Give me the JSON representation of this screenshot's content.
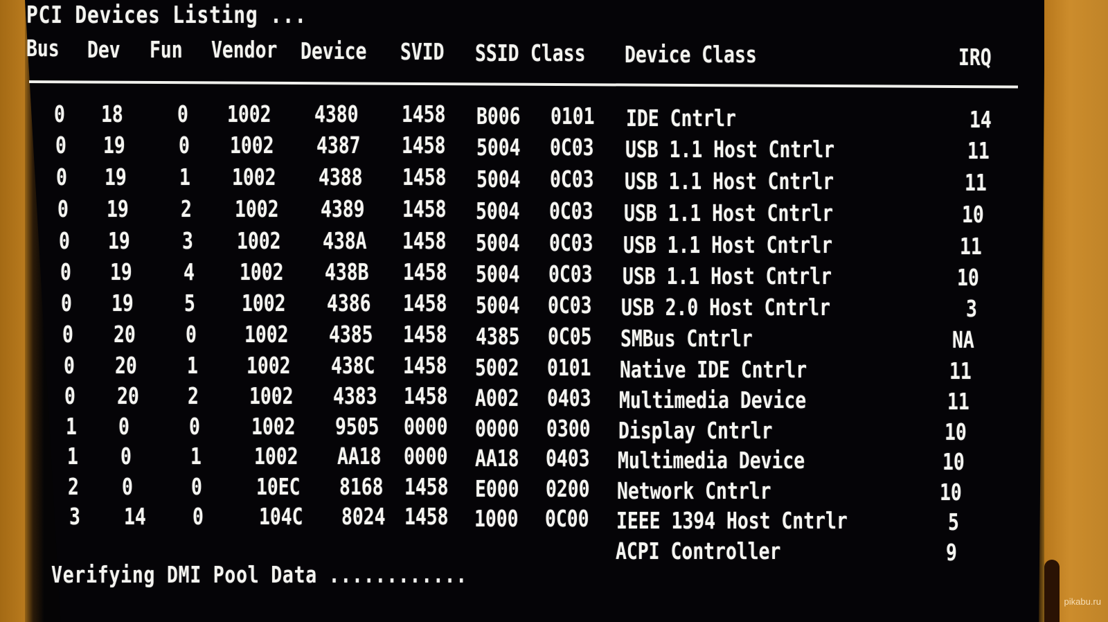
{
  "screen": {
    "title": "PCI Devices Listing ...",
    "columns": {
      "bus": "Bus",
      "dev": "Dev",
      "fun": "Fun",
      "vendor": "Vendor",
      "device": "Device",
      "svid": "SVID",
      "ssid": "SSID",
      "class": "Class",
      "device_class": "Device Class",
      "irq": "IRQ"
    },
    "rows": [
      {
        "bus": "0",
        "dev": "18",
        "fun": "0",
        "vendor": "1002",
        "device": "4380",
        "svid": "1458",
        "ssid": "B006",
        "class": "0101",
        "device_class": "IDE Cntrlr",
        "irq": "14"
      },
      {
        "bus": "0",
        "dev": "19",
        "fun": "0",
        "vendor": "1002",
        "device": "4387",
        "svid": "1458",
        "ssid": "5004",
        "class": "0C03",
        "device_class": "USB 1.1 Host Cntrlr",
        "irq": "11"
      },
      {
        "bus": "0",
        "dev": "19",
        "fun": "1",
        "vendor": "1002",
        "device": "4388",
        "svid": "1458",
        "ssid": "5004",
        "class": "0C03",
        "device_class": "USB 1.1 Host Cntrlr",
        "irq": "11"
      },
      {
        "bus": "0",
        "dev": "19",
        "fun": "2",
        "vendor": "1002",
        "device": "4389",
        "svid": "1458",
        "ssid": "5004",
        "class": "0C03",
        "device_class": "USB 1.1 Host Cntrlr",
        "irq": "10"
      },
      {
        "bus": "0",
        "dev": "19",
        "fun": "3",
        "vendor": "1002",
        "device": "438A",
        "svid": "1458",
        "ssid": "5004",
        "class": "0C03",
        "device_class": "USB 1.1 Host Cntrlr",
        "irq": "11"
      },
      {
        "bus": "0",
        "dev": "19",
        "fun": "4",
        "vendor": "1002",
        "device": "438B",
        "svid": "1458",
        "ssid": "5004",
        "class": "0C03",
        "device_class": "USB 1.1 Host Cntrlr",
        "irq": "10"
      },
      {
        "bus": "0",
        "dev": "19",
        "fun": "5",
        "vendor": "1002",
        "device": "4386",
        "svid": "1458",
        "ssid": "5004",
        "class": "0C03",
        "device_class": "USB 2.0 Host Cntrlr",
        "irq": "3"
      },
      {
        "bus": "0",
        "dev": "20",
        "fun": "0",
        "vendor": "1002",
        "device": "4385",
        "svid": "1458",
        "ssid": "4385",
        "class": "0C05",
        "device_class": "SMBus Cntrlr",
        "irq": "NA"
      },
      {
        "bus": "0",
        "dev": "20",
        "fun": "1",
        "vendor": "1002",
        "device": "438C",
        "svid": "1458",
        "ssid": "5002",
        "class": "0101",
        "device_class": "Native IDE Cntrlr",
        "irq": "11"
      },
      {
        "bus": "0",
        "dev": "20",
        "fun": "2",
        "vendor": "1002",
        "device": "4383",
        "svid": "1458",
        "ssid": "A002",
        "class": "0403",
        "device_class": "Multimedia Device",
        "irq": "11"
      },
      {
        "bus": "1",
        "dev": "0",
        "fun": "0",
        "vendor": "1002",
        "device": "9505",
        "svid": "0000",
        "ssid": "0000",
        "class": "0300",
        "device_class": "Display Cntrlr",
        "irq": "10"
      },
      {
        "bus": "1",
        "dev": "0",
        "fun": "1",
        "vendor": "1002",
        "device": "AA18",
        "svid": "0000",
        "ssid": "AA18",
        "class": "0403",
        "device_class": "Multimedia Device",
        "irq": "10"
      },
      {
        "bus": "2",
        "dev": "0",
        "fun": "0",
        "vendor": "10EC",
        "device": "8168",
        "svid": "1458",
        "ssid": "E000",
        "class": "0200",
        "device_class": "Network Cntrlr",
        "irq": "10"
      },
      {
        "bus": "3",
        "dev": "14",
        "fun": "0",
        "vendor": "104C",
        "device": "8024",
        "svid": "1458",
        "ssid": "1000",
        "class": "0C00",
        "device_class": "IEEE 1394 Host Cntrlr",
        "irq": "5"
      },
      {
        "bus": "",
        "dev": "",
        "fun": "",
        "vendor": "",
        "device": "",
        "svid": "",
        "ssid": "",
        "class": "",
        "device_class": "ACPI Controller",
        "irq": "9"
      }
    ],
    "status": "Verifying DMI Pool Data ............"
  },
  "watermark": "pikabu.ru"
}
